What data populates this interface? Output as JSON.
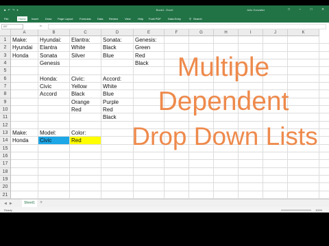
{
  "titlebar": {
    "qat": "■ ↶ ↷ ▾",
    "document": "Book4 - Excel",
    "user": "Julio Gonzalez",
    "window_controls": "□ – □ ✕"
  },
  "ribbon": {
    "tabs": [
      "File",
      "Home",
      "Insert",
      "Draw",
      "Page Layout",
      "Formulas",
      "Data",
      "Review",
      "View",
      "Help",
      "Foxit PDF",
      "Data Entry"
    ],
    "search": "Search"
  },
  "formula_bar": {
    "namebox": "I37",
    "fx": "fx",
    "value": ""
  },
  "columns": [
    "A",
    "B",
    "C",
    "D",
    "E",
    "F",
    "G",
    "H",
    "I",
    "J",
    "K"
  ],
  "rows": [
    "1",
    "2",
    "3",
    "4",
    "5",
    "6",
    "7",
    "8",
    "9",
    "10",
    "11",
    "12",
    "13",
    "14",
    "15",
    "16",
    "17",
    "18",
    "19",
    "20",
    "21"
  ],
  "cells": {
    "A1": "Make:",
    "B1": "Hyundai:",
    "C1": "Elantra:",
    "D1": "Sonata:",
    "E1": "Genesis:",
    "A2": "Hyundai",
    "B2": "Elantra",
    "C2": "White",
    "D2": "Black",
    "E2": "Green",
    "A3": "Honda",
    "B3": "Sonata",
    "C3": "Silver",
    "D3": "Blue",
    "E3": "Red",
    "B4": "Genesis",
    "E4": "Black",
    "B6": "Honda:",
    "C6": "Civic:",
    "D6": "Accord:",
    "B7": "Civic",
    "C7": "Yellow",
    "D7": "White",
    "B8": "Accord",
    "C8": "Black",
    "D8": "Blue",
    "C9": "Orange",
    "D9": "Purple",
    "C10": "Red",
    "D10": "Red",
    "D11": "Black",
    "A13": "Make:",
    "B13": "Model:",
    "C13": "Color:",
    "A14": "Honda",
    "B14": "Civic",
    "C14": "Red"
  },
  "cell_fills": {
    "B14": "#1ea7e6",
    "C14": "#ffff00"
  },
  "overlay": {
    "line1": "Multiple",
    "line2": "Dependent",
    "line3": "Drop Down Lists",
    "color": "#ee8a4c"
  },
  "sheet_tabs": [
    "Sheet1"
  ],
  "sheet_add": "+",
  "status": {
    "ready": "Ready",
    "zoom": "100%"
  },
  "colors": {
    "excel_green": "#217346",
    "cell_blue": "#1ea7e6",
    "cell_yellow": "#ffff00"
  }
}
